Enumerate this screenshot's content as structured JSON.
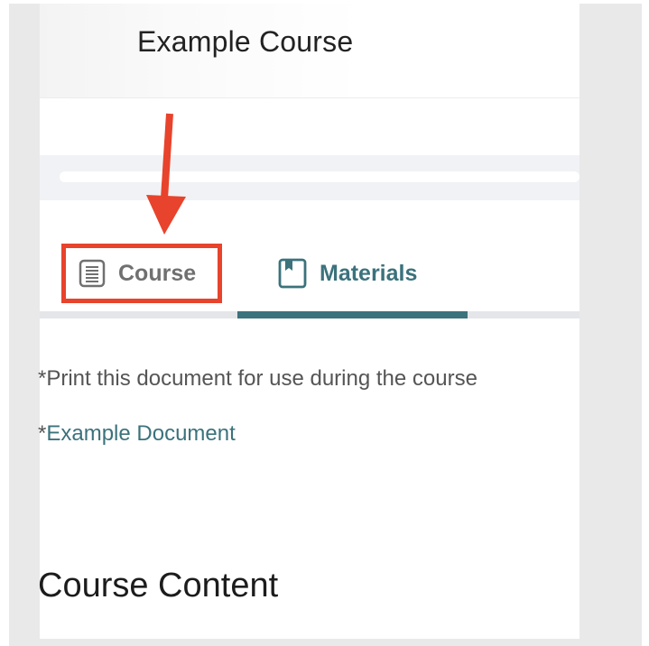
{
  "header": {
    "course_title": "Example Course"
  },
  "tabs": [
    {
      "label": "Course",
      "icon": "document-lines-icon",
      "selected": false
    },
    {
      "label": "Materials",
      "icon": "bookmark-book-icon",
      "selected": true
    }
  ],
  "annotation": {
    "color": "#e8432c"
  },
  "content": {
    "print_note": "*Print this document for use during the course",
    "doc_prefix": "*",
    "doc_link": "Example Document",
    "section_title": "Course Content"
  },
  "colors": {
    "accent": "#3b727c",
    "muted_text": "#707070",
    "annotation_red": "#e8432c"
  }
}
